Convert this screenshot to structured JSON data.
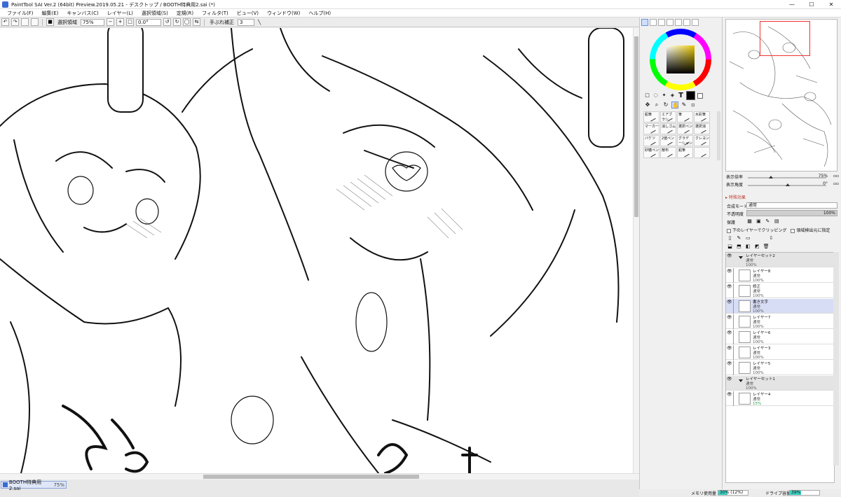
{
  "window": {
    "title": "PaintTool SAI Ver.2 (64bit) Preview.2019.05.21 - デスクトップ / BOOTH特典用2.sai (*)",
    "minimize": "—",
    "maximize": "☐",
    "close": "✕"
  },
  "menu": [
    "ファイル(F)",
    "編集(E)",
    "キャンバス(C)",
    "レイヤー(L)",
    "選択領域(S)",
    "定規(R)",
    "フィルタ(T)",
    "ビュー(V)",
    "ウィンドウ(W)",
    "ヘルプ(H)"
  ],
  "toolbar": {
    "selection_label": "選択領域",
    "zoom_value": "75%",
    "rotation_value": "0.0°",
    "stabilizer_label": "手ぶれ補正",
    "stabilizer_value": "3"
  },
  "doc_tabs": [
    {
      "name": "BOOTH特典用2.sai",
      "zoom": "75%"
    }
  ],
  "tool_panel": {
    "text_tool_glyph": "T",
    "brushes": [
      "鉛筆",
      "エアブラシ",
      "筆",
      "水彩筆",
      "マーカー",
      "消しゴム",
      "選択ペン",
      "選択消",
      "バケツ",
      "2値ペン",
      "グラデーション",
      "クレヨン",
      "砂糖ペン",
      "散布",
      "鉛筆",
      ""
    ]
  },
  "navigator": {
    "zoom_label": "表示倍率",
    "zoom_value": "75%",
    "angle_label": "表示角度",
    "angle_value": "0°"
  },
  "layer_props": {
    "effects_label": "▸ 特殊効果",
    "blend_label": "合成モード",
    "blend_value": "通常",
    "opacity_label": "不透明度",
    "opacity_value": "100%",
    "opacity_fraction": 1.0,
    "protect_label": "保護",
    "clip_label": "下のレイヤーでクリッピング",
    "select_source_label": "領域検出元に指定"
  },
  "layers": [
    {
      "name": "レイヤーセット2",
      "mode": "通常",
      "opacity": "100%",
      "kind": "set",
      "selected": false
    },
    {
      "name": "レイヤー8",
      "mode": "通常",
      "opacity": "100%",
      "kind": "layer",
      "selected": false
    },
    {
      "name": "修正",
      "mode": "通常",
      "opacity": "100%",
      "kind": "layer",
      "selected": false
    },
    {
      "name": "書き文字",
      "mode": "通常",
      "opacity": "100%",
      "kind": "layer",
      "selected": true
    },
    {
      "name": "レイヤー7",
      "mode": "通常",
      "opacity": "100%",
      "kind": "layer",
      "selected": false
    },
    {
      "name": "レイヤー6",
      "mode": "通常",
      "opacity": "100%",
      "kind": "layer",
      "selected": false
    },
    {
      "name": "レイヤー3",
      "mode": "通常",
      "opacity": "100%",
      "kind": "layer",
      "selected": false
    },
    {
      "name": "レイヤー5",
      "mode": "通常",
      "opacity": "100%",
      "kind": "layer",
      "selected": false
    },
    {
      "name": "レイヤーセット1",
      "mode": "通常",
      "opacity": "100%",
      "kind": "set",
      "selected": false
    },
    {
      "name": "レイヤー4",
      "mode": "通常",
      "opacity": "15%",
      "kind": "layer",
      "selected": false,
      "opacity_color": "#2a9d4a"
    }
  ],
  "status": {
    "memory_label": "メモリ使用量",
    "memory_value": "30% (12%)",
    "memory_fraction": 0.3,
    "drive_label": "ドライブ容量",
    "drive_value": "39%",
    "drive_fraction": 0.39
  },
  "colors": {
    "accent": "#3a6bd4",
    "selected_layer": "#d8ddf6",
    "meter_fill": "#3fd1c3"
  }
}
